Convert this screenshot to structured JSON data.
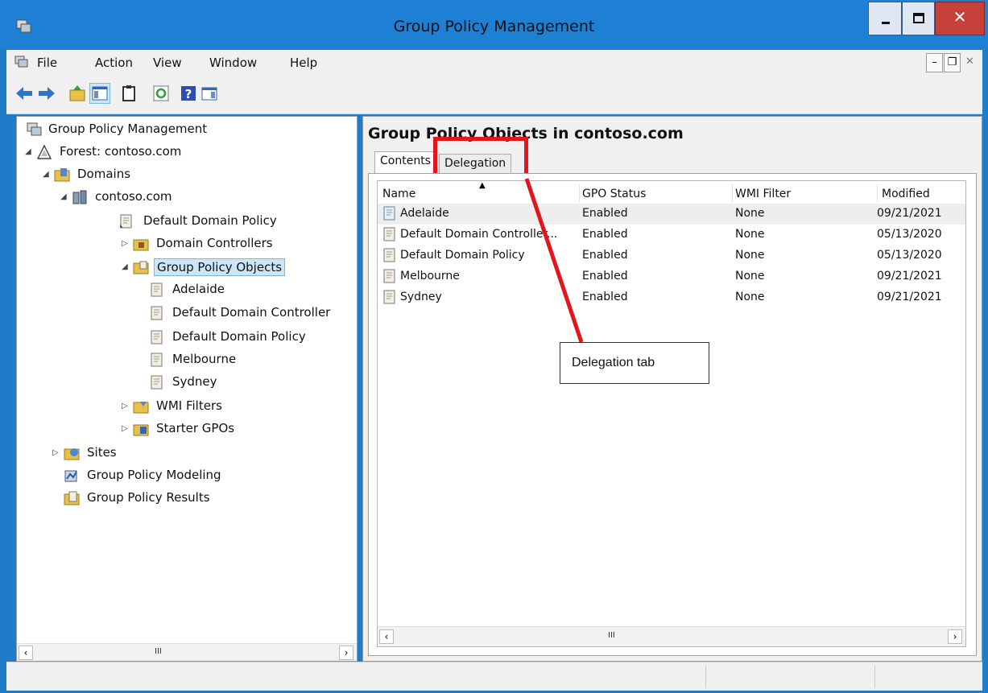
{
  "window": {
    "title": "Group Policy Management"
  },
  "menu": [
    "File",
    "Action",
    "View",
    "Window",
    "Help"
  ],
  "tree": {
    "root": "Group Policy Management",
    "forest": "Forest: contoso.com",
    "domains": "Domains",
    "domain": "contoso.com",
    "default_domain_policy": "Default Domain Policy",
    "domain_controllers": "Domain Controllers",
    "gpo_folder": "Group Policy Objects",
    "gpos": [
      "Adelaide",
      "Default Domain Controller",
      "Default Domain Policy",
      "Melbourne",
      "Sydney"
    ],
    "wmi_filters": "WMI Filters",
    "starter_gpos": "Starter GPOs",
    "sites": "Sites",
    "modeling": "Group Policy Modeling",
    "results": "Group Policy Results",
    "scroll_grip": "III"
  },
  "right": {
    "title": "Group Policy Objects in contoso.com",
    "tabs": {
      "contents": "Contents",
      "delegation": "Delegation"
    },
    "columns": {
      "name": "Name",
      "status": "GPO Status",
      "wmi": "WMI Filter",
      "modified": "Modified"
    },
    "rows": [
      {
        "name": "Adelaide",
        "status": "Enabled",
        "wmi": "None",
        "modified": "09/21/2021"
      },
      {
        "name": "Default Domain Controller...",
        "status": "Enabled",
        "wmi": "None",
        "modified": "05/13/2020"
      },
      {
        "name": "Default Domain Policy",
        "status": "Enabled",
        "wmi": "None",
        "modified": "05/13/2020"
      },
      {
        "name": "Melbourne",
        "status": "Enabled",
        "wmi": "None",
        "modified": "09/21/2021"
      },
      {
        "name": "Sydney",
        "status": "Enabled",
        "wmi": "None",
        "modified": "09/21/2021"
      }
    ],
    "scroll_grip": "III"
  },
  "callout": {
    "text": "Delegation tab",
    "color": "#e1161d"
  }
}
